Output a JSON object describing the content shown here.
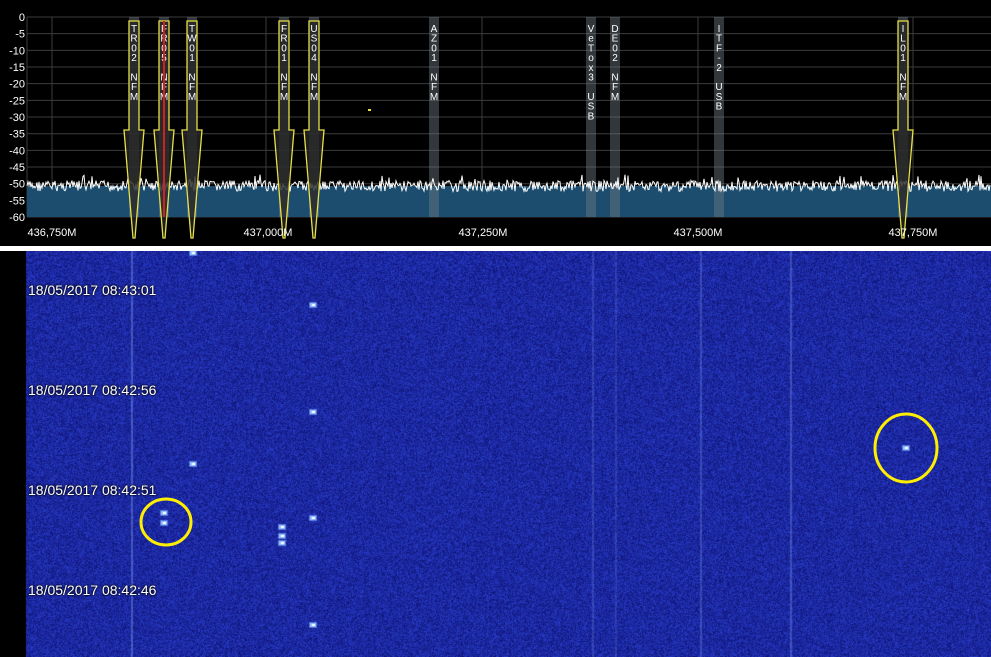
{
  "spectrum": {
    "db_ticks": [
      "0",
      "-5",
      "-10",
      "-15",
      "-20",
      "-25",
      "-30",
      "-35",
      "-40",
      "-45",
      "-50",
      "-55",
      "-60"
    ],
    "freq_ticks": [
      "436,750M",
      "437,000M",
      "437,250M",
      "437,500M",
      "437,750M"
    ],
    "bookmarks": [
      {
        "label": "TR02 NFM",
        "marker": true
      },
      {
        "label": "FR05 NFM",
        "marker": true
      },
      {
        "label": "TW01 NFM",
        "marker": true
      },
      {
        "label": "FR01 NFM",
        "marker": true
      },
      {
        "label": "US04 NFM",
        "marker": true
      },
      {
        "label": "AZ01 NFM",
        "marker": false
      },
      {
        "label": "VeTox3 USB",
        "marker": false
      },
      {
        "label": "DE02 NFM",
        "marker": false
      },
      {
        "label": "ITF-2 USB",
        "marker": false
      },
      {
        "label": "IL01 NFM",
        "marker": true
      }
    ],
    "colors": {
      "floor": "#1c4d6e",
      "trace": "#ffffff",
      "marker": "#e6e04a",
      "grid": "#444444"
    }
  },
  "waterfall": {
    "timestamps": [
      "18/05/2017 08:43:01",
      "18/05/2017 08:42:56",
      "18/05/2017 08:42:51",
      "18/05/2017 08:42:46"
    ],
    "colors": {
      "background": "#14168a",
      "highlight": "#ffee00"
    }
  }
}
